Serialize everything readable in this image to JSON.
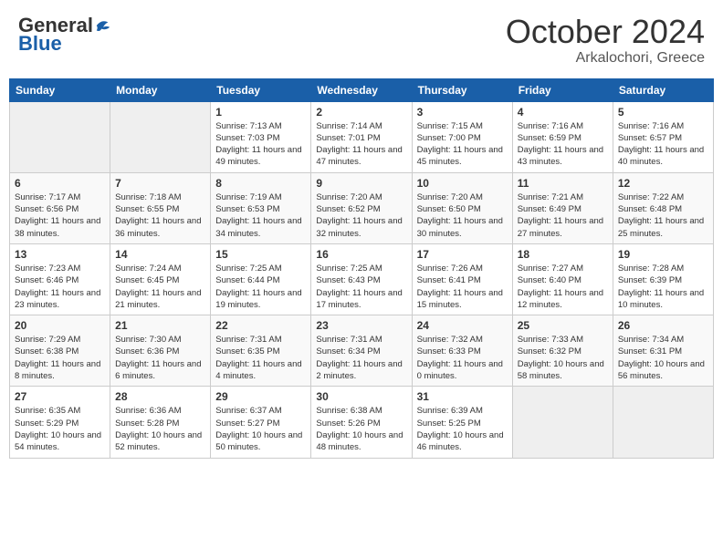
{
  "header": {
    "logo": {
      "general": "General",
      "blue": "Blue"
    },
    "title": "October 2024",
    "subtitle": "Arkalochori, Greece"
  },
  "weekdays": [
    "Sunday",
    "Monday",
    "Tuesday",
    "Wednesday",
    "Thursday",
    "Friday",
    "Saturday"
  ],
  "weeks": [
    [
      null,
      null,
      {
        "day": 1,
        "sunrise": "7:13 AM",
        "sunset": "7:03 PM",
        "daylight": "11 hours and 49 minutes."
      },
      {
        "day": 2,
        "sunrise": "7:14 AM",
        "sunset": "7:01 PM",
        "daylight": "11 hours and 47 minutes."
      },
      {
        "day": 3,
        "sunrise": "7:15 AM",
        "sunset": "7:00 PM",
        "daylight": "11 hours and 45 minutes."
      },
      {
        "day": 4,
        "sunrise": "7:16 AM",
        "sunset": "6:59 PM",
        "daylight": "11 hours and 43 minutes."
      },
      {
        "day": 5,
        "sunrise": "7:16 AM",
        "sunset": "6:57 PM",
        "daylight": "11 hours and 40 minutes."
      }
    ],
    [
      {
        "day": 6,
        "sunrise": "7:17 AM",
        "sunset": "6:56 PM",
        "daylight": "11 hours and 38 minutes."
      },
      {
        "day": 7,
        "sunrise": "7:18 AM",
        "sunset": "6:55 PM",
        "daylight": "11 hours and 36 minutes."
      },
      {
        "day": 8,
        "sunrise": "7:19 AM",
        "sunset": "6:53 PM",
        "daylight": "11 hours and 34 minutes."
      },
      {
        "day": 9,
        "sunrise": "7:20 AM",
        "sunset": "6:52 PM",
        "daylight": "11 hours and 32 minutes."
      },
      {
        "day": 10,
        "sunrise": "7:20 AM",
        "sunset": "6:50 PM",
        "daylight": "11 hours and 30 minutes."
      },
      {
        "day": 11,
        "sunrise": "7:21 AM",
        "sunset": "6:49 PM",
        "daylight": "11 hours and 27 minutes."
      },
      {
        "day": 12,
        "sunrise": "7:22 AM",
        "sunset": "6:48 PM",
        "daylight": "11 hours and 25 minutes."
      }
    ],
    [
      {
        "day": 13,
        "sunrise": "7:23 AM",
        "sunset": "6:46 PM",
        "daylight": "11 hours and 23 minutes."
      },
      {
        "day": 14,
        "sunrise": "7:24 AM",
        "sunset": "6:45 PM",
        "daylight": "11 hours and 21 minutes."
      },
      {
        "day": 15,
        "sunrise": "7:25 AM",
        "sunset": "6:44 PM",
        "daylight": "11 hours and 19 minutes."
      },
      {
        "day": 16,
        "sunrise": "7:25 AM",
        "sunset": "6:43 PM",
        "daylight": "11 hours and 17 minutes."
      },
      {
        "day": 17,
        "sunrise": "7:26 AM",
        "sunset": "6:41 PM",
        "daylight": "11 hours and 15 minutes."
      },
      {
        "day": 18,
        "sunrise": "7:27 AM",
        "sunset": "6:40 PM",
        "daylight": "11 hours and 12 minutes."
      },
      {
        "day": 19,
        "sunrise": "7:28 AM",
        "sunset": "6:39 PM",
        "daylight": "11 hours and 10 minutes."
      }
    ],
    [
      {
        "day": 20,
        "sunrise": "7:29 AM",
        "sunset": "6:38 PM",
        "daylight": "11 hours and 8 minutes."
      },
      {
        "day": 21,
        "sunrise": "7:30 AM",
        "sunset": "6:36 PM",
        "daylight": "11 hours and 6 minutes."
      },
      {
        "day": 22,
        "sunrise": "7:31 AM",
        "sunset": "6:35 PM",
        "daylight": "11 hours and 4 minutes."
      },
      {
        "day": 23,
        "sunrise": "7:31 AM",
        "sunset": "6:34 PM",
        "daylight": "11 hours and 2 minutes."
      },
      {
        "day": 24,
        "sunrise": "7:32 AM",
        "sunset": "6:33 PM",
        "daylight": "11 hours and 0 minutes."
      },
      {
        "day": 25,
        "sunrise": "7:33 AM",
        "sunset": "6:32 PM",
        "daylight": "10 hours and 58 minutes."
      },
      {
        "day": 26,
        "sunrise": "7:34 AM",
        "sunset": "6:31 PM",
        "daylight": "10 hours and 56 minutes."
      }
    ],
    [
      {
        "day": 27,
        "sunrise": "6:35 AM",
        "sunset": "5:29 PM",
        "daylight": "10 hours and 54 minutes."
      },
      {
        "day": 28,
        "sunrise": "6:36 AM",
        "sunset": "5:28 PM",
        "daylight": "10 hours and 52 minutes."
      },
      {
        "day": 29,
        "sunrise": "6:37 AM",
        "sunset": "5:27 PM",
        "daylight": "10 hours and 50 minutes."
      },
      {
        "day": 30,
        "sunrise": "6:38 AM",
        "sunset": "5:26 PM",
        "daylight": "10 hours and 48 minutes."
      },
      {
        "day": 31,
        "sunrise": "6:39 AM",
        "sunset": "5:25 PM",
        "daylight": "10 hours and 46 minutes."
      },
      null,
      null
    ]
  ]
}
